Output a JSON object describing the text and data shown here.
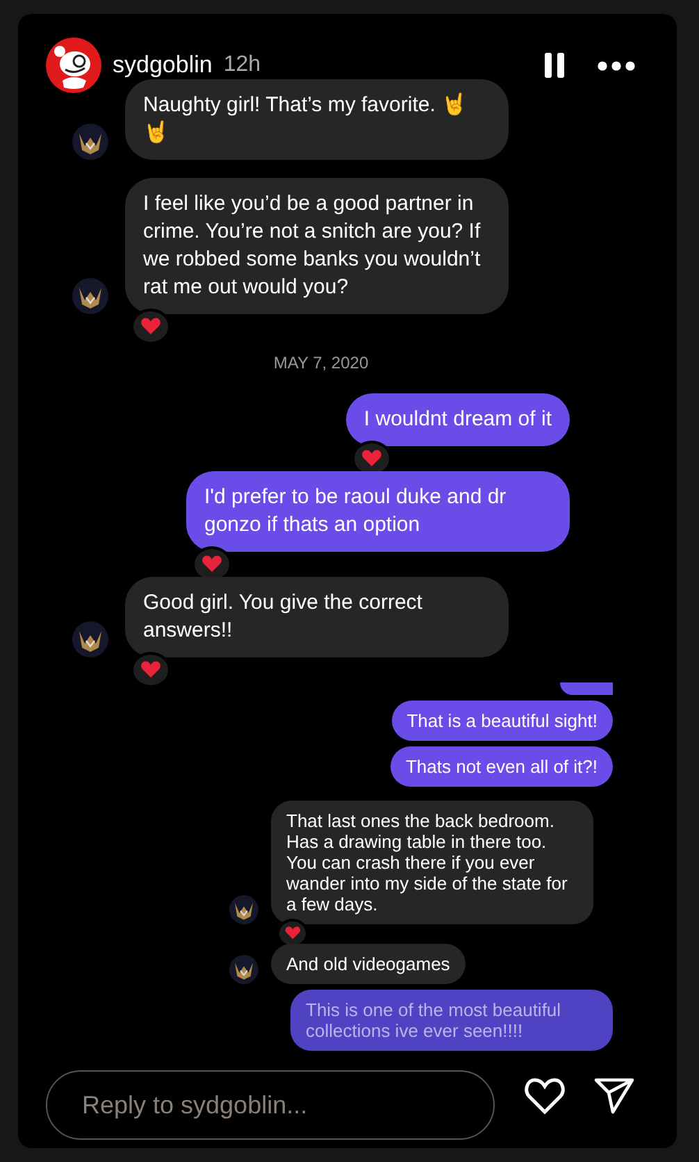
{
  "header": {
    "username": "sydgoblin",
    "time": "12h"
  },
  "sections": [
    {
      "messages": [
        {
          "kind": "incoming",
          "text": "Naughty girl! That’s my favorite. 🤘🤘",
          "avatar": true,
          "reacted": false
        },
        {
          "kind": "incoming",
          "text": "I feel like you’d be a good partner in crime. You’re not a snitch are you? If we robbed some banks you wouldn’t rat me out would you?",
          "avatar": true,
          "reacted": true
        },
        {
          "kind": "date",
          "text": "MAY 7, 2020"
        },
        {
          "kind": "outgoing",
          "text": "I wouldnt dream of it",
          "reacted": true
        },
        {
          "kind": "outgoing",
          "text": "I'd prefer to be raoul duke and dr gonzo if thats an option",
          "reacted": true
        },
        {
          "kind": "incoming",
          "text": "Good girl. You give the correct answers!!",
          "avatar": true,
          "reacted": true
        }
      ]
    },
    {
      "messages": [
        {
          "kind": "fragment"
        },
        {
          "kind": "outgoing",
          "text": "That is a beautiful sight!",
          "reacted": false
        },
        {
          "kind": "outgoing",
          "text": "Thats not even all of it?!",
          "reacted": false
        },
        {
          "kind": "incoming",
          "text": "That last ones the back bedroom. Has a drawing table in there too. You can crash there if you ever wander into my side of the state for a few days.",
          "avatar": true,
          "reacted": true
        },
        {
          "kind": "incoming",
          "text": "And old videogames",
          "avatar": true,
          "reacted": false
        },
        {
          "kind": "outgoing",
          "text": "This is one of the most beautiful collections ive ever seen!!!!",
          "reacted": false
        }
      ]
    }
  ],
  "reply": {
    "placeholder": "Reply to sydgoblin..."
  }
}
